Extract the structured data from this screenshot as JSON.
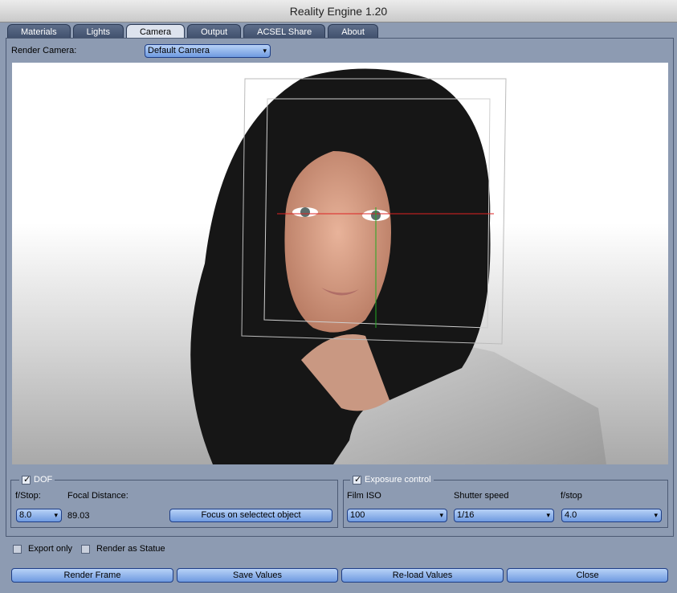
{
  "window": {
    "title": "Reality Engine 1.20"
  },
  "tabs": [
    {
      "label": "Materials"
    },
    {
      "label": "Lights"
    },
    {
      "label": "Camera"
    },
    {
      "label": "Output"
    },
    {
      "label": "ACSEL Share"
    },
    {
      "label": "About"
    }
  ],
  "active_tab": "Camera",
  "render_camera": {
    "label": "Render Camera:",
    "value": "Default Camera"
  },
  "dof": {
    "label": "DOF",
    "checked": true,
    "fstop_label": "f/Stop:",
    "fstop_value": "8.0",
    "focal_label": "Focal Distance:",
    "focal_value": "89.03",
    "focus_button": "Focus on selectect object"
  },
  "exposure": {
    "label": "Exposure control",
    "checked": true,
    "iso_label": "Film ISO",
    "iso_value": "100",
    "shutter_label": "Shutter speed",
    "shutter_value": "1/16",
    "fstop_label": "f/stop",
    "fstop_value": "4.0"
  },
  "options": {
    "export_only": "Export only",
    "render_statue": "Render as Statue"
  },
  "buttons": {
    "render": "Render Frame",
    "save": "Save Values",
    "reload": "Re-load Values",
    "close": "Close"
  }
}
